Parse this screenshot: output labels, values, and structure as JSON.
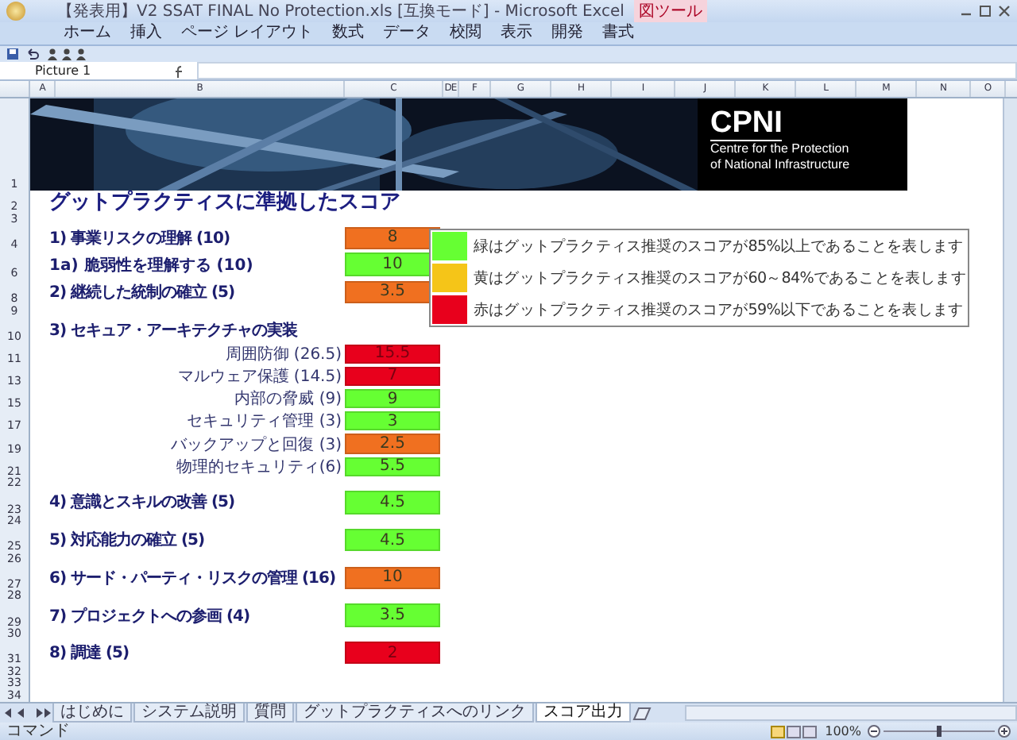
{
  "window": {
    "title": "【発表用】V2 SSAT FINAL No Protection.xls [互換モード] - Microsoft Excel",
    "context_tab": "図ツール"
  },
  "ribbon_tabs": [
    "ホーム",
    "挿入",
    "ページ レイアウト",
    "数式",
    "データ",
    "校閲",
    "表示",
    "開発",
    "書式"
  ],
  "name_box": "Picture 1",
  "columns": [
    "A",
    "B",
    "C",
    "DE",
    "F",
    "G",
    "H",
    "I",
    "J",
    "K",
    "L",
    "M",
    "N",
    "O"
  ],
  "banner": {
    "row": "1",
    "kind": "picture",
    "logo": "CPNI",
    "logo_lines": [
      "Centre for the Protection",
      "of National Infrastructure"
    ]
  },
  "rows": [
    {
      "number": "2",
      "kind": "title",
      "label": "グットプラクティスに準拠したスコア"
    },
    {
      "number": "3",
      "kind": "blank"
    },
    {
      "number": "4",
      "kind": "section",
      "label": "1) 事業リスクの理解 (10)",
      "score": "8",
      "color": "#f07020"
    },
    {
      "number": "6",
      "kind": "subsection",
      "label": "1a) 脆弱性を理解する (10)",
      "score": "10",
      "color": "#66ff33"
    },
    {
      "number": "8",
      "kind": "section",
      "label": "2) 継続した統制の確立 (5)",
      "score": "3.5",
      "color": "#f07020"
    },
    {
      "number": "9",
      "kind": "blank"
    },
    {
      "number": "10",
      "kind": "section",
      "label": "3) セキュア・アーキテクチャの実装"
    },
    {
      "number": "11",
      "kind": "item",
      "label": "周囲防御 (26.5)",
      "score": "15.5",
      "color": "#e8001c"
    },
    {
      "number": "13",
      "kind": "item",
      "label": "マルウェア保護 (14.5)",
      "score": "7",
      "color": "#e8001c"
    },
    {
      "number": "15",
      "kind": "item",
      "label": "内部の脅威 (9)",
      "score": "9",
      "color": "#66ff33"
    },
    {
      "number": "17",
      "kind": "item",
      "label": "セキュリティ管理 (3)",
      "score": "3",
      "color": "#66ff33"
    },
    {
      "number": "19",
      "kind": "item",
      "label": "バックアップと回復 (3)",
      "score": "2.5",
      "color": "#f07020"
    },
    {
      "number": "21",
      "kind": "item",
      "label": "物理的セキュリティ(6)",
      "score": "5.5",
      "color": "#66ff33"
    },
    {
      "number": "22",
      "kind": "blank"
    },
    {
      "number": "23",
      "kind": "section",
      "label": "4) 意識とスキルの改善 (5)",
      "score": "4.5",
      "color": "#66ff33"
    },
    {
      "number": "24",
      "kind": "blank"
    },
    {
      "number": "25",
      "kind": "section",
      "label": "5) 対応能力の確立 (5)",
      "score": "4.5",
      "color": "#66ff33"
    },
    {
      "number": "26",
      "kind": "blank"
    },
    {
      "number": "27",
      "kind": "section",
      "label": "6) サード・パーティ・リスクの管理 (16)",
      "score": "10",
      "color": "#f07020"
    },
    {
      "number": "28",
      "kind": "blank"
    },
    {
      "number": "29",
      "kind": "section",
      "label": "7) プロジェクトへの参画 (4)",
      "score": "3.5",
      "color": "#66ff33"
    },
    {
      "number": "30",
      "kind": "blank"
    },
    {
      "number": "31",
      "kind": "section",
      "label": "8) 調達 (5)",
      "score": "2",
      "color": "#e8001c"
    },
    {
      "number": "32",
      "kind": "blank"
    },
    {
      "number": "33",
      "kind": "blank"
    },
    {
      "number": "34",
      "kind": "blank"
    }
  ],
  "legend": [
    {
      "color": "#66ff33",
      "text": "緑はグットプラクティス推奨のスコアが85%以上であることを表します"
    },
    {
      "color": "#f5c518",
      "text": "黄はグットプラクティス推奨のスコアが60～84%であることを表します"
    },
    {
      "color": "#e8001c",
      "text": "赤はグットプラクティス推奨のスコアが59%以下であることを表します"
    }
  ],
  "sheet_tabs": [
    {
      "label": "はじめに",
      "selected": false
    },
    {
      "label": "システム説明",
      "selected": false
    },
    {
      "label": "質問",
      "selected": false
    },
    {
      "label": "グットプラクティスへのリンク",
      "selected": false
    },
    {
      "label": "スコア出力",
      "selected": true
    }
  ],
  "status": {
    "mode": "コマンド",
    "zoom": "100%",
    "zoom_slider": {
      "level": 0.5
    }
  }
}
